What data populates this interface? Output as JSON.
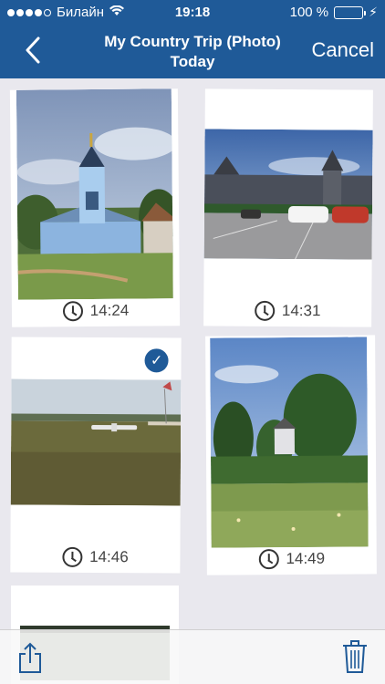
{
  "status_bar": {
    "carrier": "Билайн",
    "time": "19:18",
    "battery": "100 %",
    "battery_level": 1.0
  },
  "nav": {
    "title": "My Country Trip (Photo)",
    "subtitle": "Today",
    "cancel": "Cancel"
  },
  "photos": [
    {
      "time": "14:24",
      "selected": false
    },
    {
      "time": "14:31",
      "selected": false
    },
    {
      "time": "14:46",
      "selected": true
    },
    {
      "time": "14:49",
      "selected": false
    }
  ],
  "icons": {
    "back": "chevron-left-icon",
    "share": "share-icon",
    "trash": "trash-icon",
    "clock": "clock-icon",
    "check": "checkmark-icon"
  },
  "colors": {
    "accent": "#1f5a98",
    "battery": "#4cd964"
  }
}
